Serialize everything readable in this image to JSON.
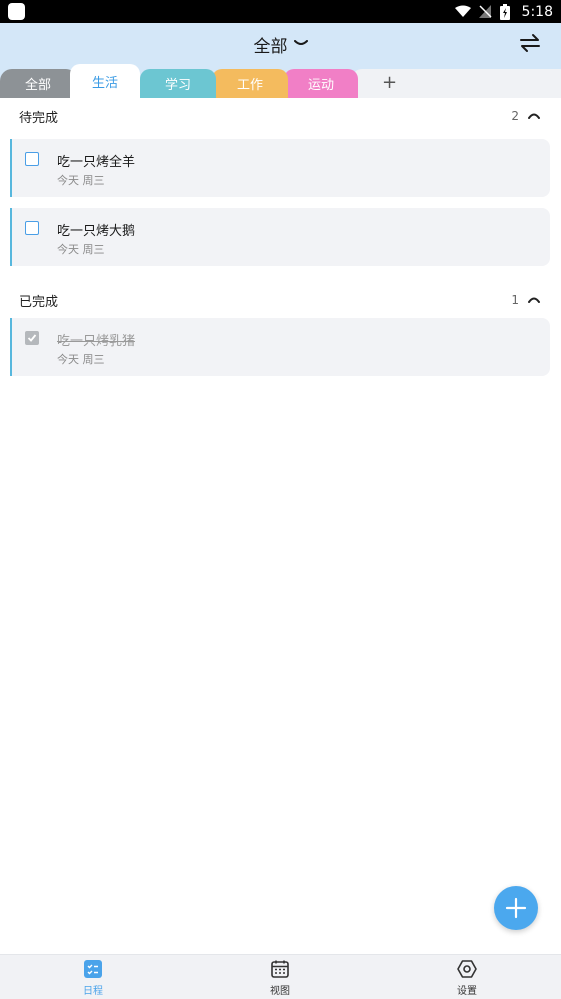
{
  "status_bar": {
    "time": "5:18"
  },
  "header": {
    "title": "全部",
    "tabs": [
      {
        "label": "全部",
        "color": "#8d9296"
      },
      {
        "label": "生活",
        "color": "#ffffff",
        "active": true
      },
      {
        "label": "学习",
        "color": "#6cc6d2"
      },
      {
        "label": "工作",
        "color": "#f4bb5e"
      },
      {
        "label": "运动",
        "color": "#f17fc6"
      }
    ],
    "add_tab_label": "+"
  },
  "pending": {
    "title": "待完成",
    "count": "2",
    "items": [
      {
        "title": "吃一只烤全羊",
        "date": "今天 周三"
      },
      {
        "title": "吃一只烤大鹅",
        "date": "今天 周三"
      }
    ]
  },
  "done": {
    "title": "已完成",
    "count": "1",
    "items": [
      {
        "title": "吃一只烤乳猪",
        "date": "今天 周三"
      }
    ]
  },
  "bottom_nav": [
    {
      "label": "日程",
      "icon": "schedule-icon",
      "active": true
    },
    {
      "label": "视图",
      "icon": "calendar-icon"
    },
    {
      "label": "设置",
      "icon": "settings-icon"
    }
  ],
  "colors": {
    "accent": "#4aa3ea",
    "header_bg": "#d4e7f8"
  }
}
